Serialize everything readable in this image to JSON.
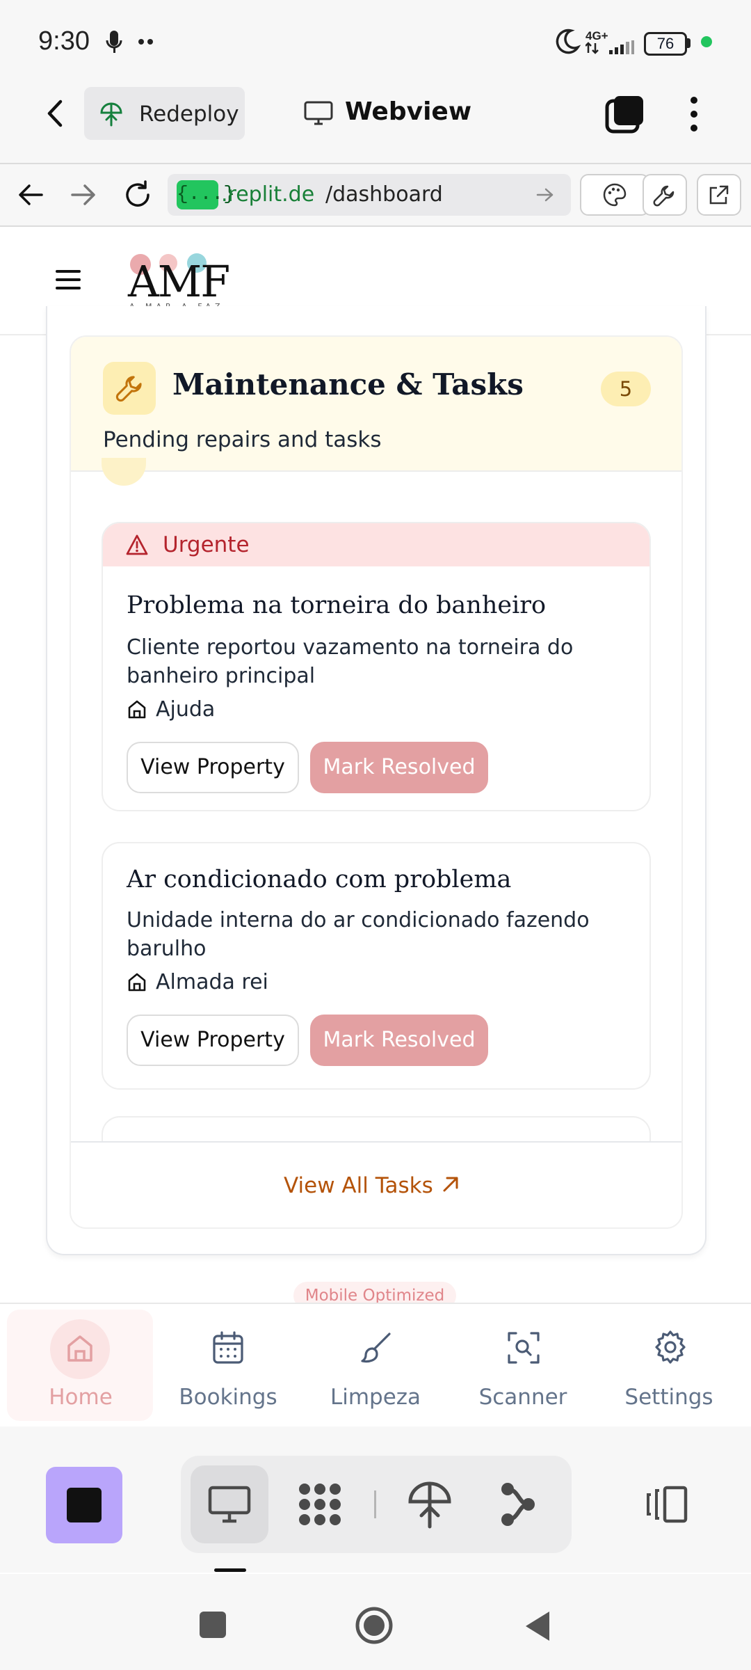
{
  "status_bar": {
    "time": "9:30",
    "network": "4G+",
    "battery": "76"
  },
  "replit_bar": {
    "redeploy_label": "Redeploy",
    "webview_label": "Webview"
  },
  "browser": {
    "url_chip": "{...}",
    "url_domain": ".replit.de",
    "url_path": "/dashboard"
  },
  "header": {
    "logo_text": "AMF",
    "logo_tagline": "A MAR A FAZ"
  },
  "section": {
    "title": "Maintenance & Tasks",
    "subtitle": "Pending repairs and tasks",
    "count": "5",
    "view_all_label": "View All Tasks"
  },
  "tasks": [
    {
      "badge": "Urgente",
      "title": "Problema na torneira do banheiro",
      "description": "Cliente reportou vazamento na torneira do banheiro principal",
      "property": "Ajuda",
      "view_label": "View Property",
      "resolve_label": "Mark Resolved"
    },
    {
      "title": "Ar condicionado com problema",
      "description": "Unidade interna do ar condicionado fazendo barulho",
      "property": "Almada rei",
      "view_label": "View Property",
      "resolve_label": "Mark Resolved"
    }
  ],
  "mobile_optimized_label": "Mobile Optimized",
  "bottom_nav": [
    {
      "label": "Home",
      "icon": "home-icon",
      "active": true
    },
    {
      "label": "Bookings",
      "icon": "calendar-icon",
      "active": false
    },
    {
      "label": "Limpeza",
      "icon": "brush-icon",
      "active": false
    },
    {
      "label": "Scanner",
      "icon": "scan-icon",
      "active": false
    },
    {
      "label": "Settings",
      "icon": "gear-icon",
      "active": false
    }
  ],
  "colors": {
    "accent_pink": "#e3a0a2",
    "urgent_red": "#b4242d",
    "amber_link": "#b45309",
    "section_bg": "#fffbea",
    "url_green": "#22c55e",
    "replit_purple": "#b9a5fb"
  }
}
